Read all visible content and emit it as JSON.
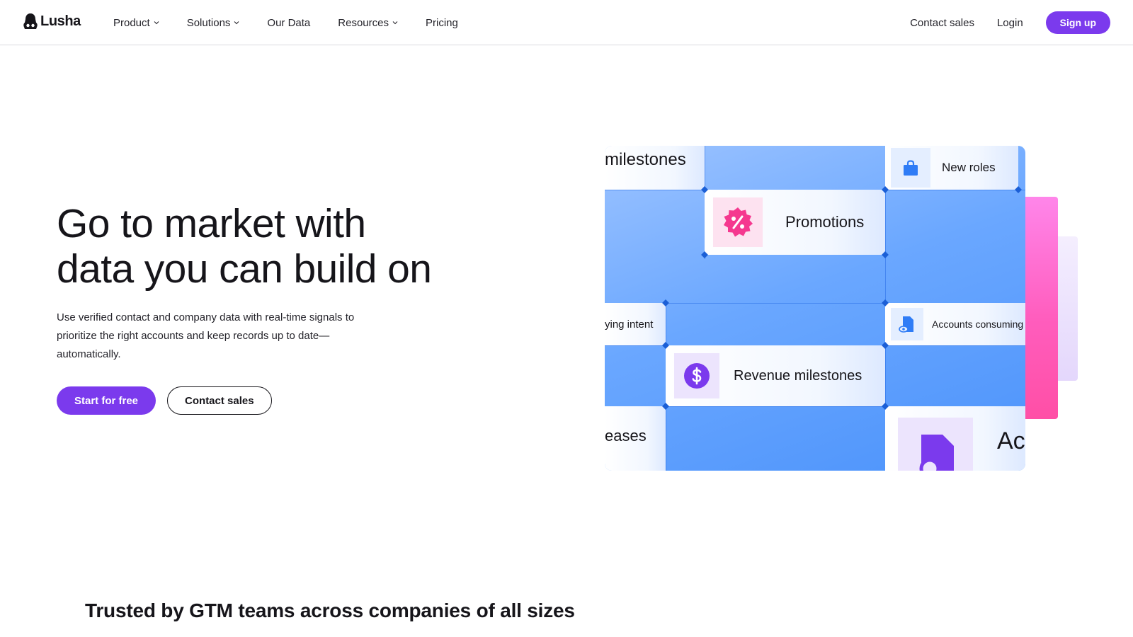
{
  "header": {
    "logo_text": "Lusha",
    "nav": [
      {
        "label": "Product",
        "has_dropdown": true
      },
      {
        "label": "Solutions",
        "has_dropdown": true
      },
      {
        "label": "Our Data",
        "has_dropdown": false
      },
      {
        "label": "Resources",
        "has_dropdown": true
      },
      {
        "label": "Pricing",
        "has_dropdown": false
      }
    ],
    "contact_sales": "Contact sales",
    "login": "Login",
    "signup": "Sign up"
  },
  "hero": {
    "title_line1": "Go to market with",
    "title_line2": "data you can build on",
    "subtitle": "Use verified contact and company data with real-time signals to prioritize the right accounts and keep records up to date—automatically.",
    "primary_cta": "Start for free",
    "secondary_cta": "Contact sales"
  },
  "visual": {
    "tiles": {
      "milestones": "milestones",
      "new_roles": "New roles",
      "promotions": "Promotions",
      "buying_intent": "ying intent",
      "accounts_consuming": "Accounts consuming",
      "revenue_milestones": "Revenue milestones",
      "releases": "eases",
      "ac": "Ac"
    },
    "icons": [
      "briefcase-icon",
      "discount-badge-icon",
      "dollar-coin-icon",
      "document-eye-icon",
      "document-icon"
    ],
    "colors": {
      "accent": "#7b3aed",
      "blue": "#4c93fb",
      "pink": "#ff4fa6",
      "icon_pink": "#f5388f",
      "icon_purple": "#7b3aed",
      "icon_blue": "#2f7cf6"
    }
  },
  "trusted": {
    "text": "Trusted by GTM teams across companies of all sizes"
  }
}
